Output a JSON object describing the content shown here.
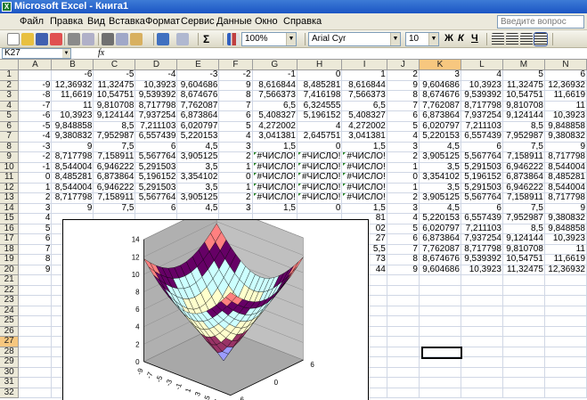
{
  "window": {
    "title": "Microsoft Excel - Книга1"
  },
  "menu": {
    "items": [
      "Файл",
      "Правка",
      "Вид",
      "Вставка",
      "Формат",
      "Сервис",
      "Данные",
      "Окно",
      "Справка"
    ],
    "help_placeholder": "Введите вопрос"
  },
  "toolbar": {
    "zoom": "100%",
    "font_name": "Arial Cyr",
    "font_size": "10",
    "bold": "Ж",
    "italic": "К",
    "underline": "Ч",
    "icons": [
      "new-icon",
      "open-icon",
      "save-icon",
      "permission-icon",
      "print-icon",
      "print-preview-icon",
      "cut-icon",
      "copy-icon",
      "paste-icon",
      "undo-icon",
      "redo-icon",
      "autosum-icon",
      "chart-wizard-icon",
      "align-left-icon",
      "align-center-icon",
      "align-right-icon",
      "merge-icon"
    ]
  },
  "formula_bar": {
    "name_box": "K27",
    "fx": "fx"
  },
  "sheet": {
    "columns": [
      "A",
      "B",
      "C",
      "D",
      "E",
      "F",
      "G",
      "H",
      "I",
      "J",
      "K",
      "L",
      "M",
      "N"
    ],
    "selected_column": "K",
    "selected_row": "27",
    "rows": [
      {
        "n": "1",
        "c": [
          "",
          "-6",
          "-5",
          "-4",
          "-3",
          "-2",
          "-1",
          "0",
          "1",
          "2",
          "3",
          "4",
          "5",
          "6"
        ]
      },
      {
        "n": "2",
        "c": [
          "-9",
          "12,36932",
          "11,32475",
          "10,3923",
          "9,604686",
          "9",
          "8,616844",
          "8,485281",
          "8,616844",
          "9",
          "9,604686",
          "10,3923",
          "11,32475",
          "12,36932"
        ]
      },
      {
        "n": "3",
        "c": [
          "-8",
          "11,6619",
          "10,54751",
          "9,539392",
          "8,674676",
          "8",
          "7,566373",
          "7,416198",
          "7,566373",
          "8",
          "8,674676",
          "9,539392",
          "10,54751",
          "11,6619"
        ]
      },
      {
        "n": "4",
        "c": [
          "-7",
          "11",
          "9,810708",
          "8,717798",
          "7,762087",
          "7",
          "6,5",
          "6,324555",
          "6,5",
          "7",
          "7,762087",
          "8,717798",
          "9,810708",
          "11"
        ]
      },
      {
        "n": "5",
        "c": [
          "-6",
          "10,3923",
          "9,124144",
          "7,937254",
          "6,873864",
          "6",
          "5,408327",
          "5,196152",
          "5,408327",
          "6",
          "6,873864",
          "7,937254",
          "9,124144",
          "10,3923"
        ]
      },
      {
        "n": "6",
        "c": [
          "-5",
          "9,848858",
          "8,5",
          "7,211103",
          "6,020797",
          "5",
          "4,272002",
          "4",
          "4,272002",
          "5",
          "6,020797",
          "7,211103",
          "8,5",
          "9,848858"
        ]
      },
      {
        "n": "7",
        "c": [
          "-4",
          "9,380832",
          "7,952987",
          "6,557439",
          "5,220153",
          "4",
          "3,041381",
          "2,645751",
          "3,041381",
          "4",
          "5,220153",
          "6,557439",
          "7,952987",
          "9,380832"
        ]
      },
      {
        "n": "8",
        "c": [
          "-3",
          "9",
          "7,5",
          "6",
          "4,5",
          "3",
          "1,5",
          "0",
          "1,5",
          "3",
          "4,5",
          "6",
          "7,5",
          "9"
        ]
      },
      {
        "n": "9",
        "c": [
          "-2",
          "8,717798",
          "7,158911",
          "5,567764",
          "3,905125",
          "2",
          "#ЧИСЛО!",
          "#ЧИСЛО!",
          "#ЧИСЛО!",
          "2",
          "3,905125",
          "5,567764",
          "7,158911",
          "8,717798"
        ]
      },
      {
        "n": "10",
        "c": [
          "-1",
          "8,544004",
          "6,946222",
          "5,291503",
          "3,5",
          "1",
          "#ЧИСЛО!",
          "#ЧИСЛО!",
          "#ЧИСЛО!",
          "1",
          "3,5",
          "5,291503",
          "6,946222",
          "8,544004"
        ]
      },
      {
        "n": "11",
        "c": [
          "0",
          "8,485281",
          "6,873864",
          "5,196152",
          "3,354102",
          "0",
          "#ЧИСЛО!",
          "#ЧИСЛО!",
          "#ЧИСЛО!",
          "0",
          "3,354102",
          "5,196152",
          "6,873864",
          "8,485281"
        ]
      },
      {
        "n": "12",
        "c": [
          "1",
          "8,544004",
          "6,946222",
          "5,291503",
          "3,5",
          "1",
          "#ЧИСЛО!",
          "#ЧИСЛО!",
          "#ЧИСЛО!",
          "1",
          "3,5",
          "5,291503",
          "6,946222",
          "8,544004"
        ]
      },
      {
        "n": "13",
        "c": [
          "2",
          "8,717798",
          "7,158911",
          "5,567764",
          "3,905125",
          "2",
          "#ЧИСЛО!",
          "#ЧИСЛО!",
          "#ЧИСЛО!",
          "2",
          "3,905125",
          "5,567764",
          "7,158911",
          "8,717798"
        ]
      },
      {
        "n": "14",
        "c": [
          "3",
          "9",
          "7,5",
          "6",
          "4,5",
          "3",
          "1,5",
          "0",
          "1,5",
          "3",
          "4,5",
          "6",
          "7,5",
          "9"
        ]
      },
      {
        "n": "15",
        "c": [
          "4",
          "",
          "",
          "",
          "",
          "",
          "",
          "",
          "81",
          "4",
          "5,220153",
          "6,557439",
          "7,952987",
          "9,380832"
        ]
      },
      {
        "n": "16",
        "c": [
          "5",
          "",
          "",
          "",
          "",
          "",
          "",
          "",
          "02",
          "5",
          "6,020797",
          "7,211103",
          "8,5",
          "9,848858"
        ]
      },
      {
        "n": "17",
        "c": [
          "6",
          "",
          "",
          "",
          "",
          "",
          "",
          "",
          "27",
          "6",
          "6,873864",
          "7,937254",
          "9,124144",
          "10,3923"
        ]
      },
      {
        "n": "18",
        "c": [
          "7",
          "",
          "",
          "",
          "",
          "",
          "",
          "",
          "5,5",
          "7",
          "7,762087",
          "8,717798",
          "9,810708",
          "11"
        ]
      },
      {
        "n": "19",
        "c": [
          "8",
          "",
          "",
          "",
          "",
          "",
          "",
          "",
          "73",
          "8",
          "8,674676",
          "9,539392",
          "10,54751",
          "11,6619"
        ]
      },
      {
        "n": "20",
        "c": [
          "9",
          "",
          "",
          "",
          "",
          "",
          "",
          "",
          "44",
          "9",
          "9,604686",
          "10,3923",
          "11,32475",
          "12,36932"
        ]
      },
      {
        "n": "21",
        "c": [
          "",
          "",
          "",
          "",
          "",
          "",
          "",
          "",
          "",
          "",
          "",
          "",
          "",
          ""
        ]
      },
      {
        "n": "22",
        "c": [
          "",
          "",
          "",
          "",
          "",
          "",
          "",
          "",
          "",
          "",
          "",
          "",
          "",
          ""
        ]
      },
      {
        "n": "23",
        "c": [
          "",
          "",
          "",
          "",
          "",
          "",
          "",
          "",
          "",
          "",
          "",
          "",
          "",
          ""
        ]
      },
      {
        "n": "24",
        "c": [
          "",
          "",
          "",
          "",
          "",
          "",
          "",
          "",
          "",
          "",
          "",
          "",
          "",
          ""
        ]
      },
      {
        "n": "25",
        "c": [
          "",
          "",
          "",
          "",
          "",
          "",
          "",
          "",
          "",
          "",
          "",
          "",
          "",
          ""
        ]
      },
      {
        "n": "26",
        "c": [
          "",
          "",
          "",
          "",
          "",
          "",
          "",
          "",
          "",
          "",
          "",
          "",
          "",
          ""
        ]
      },
      {
        "n": "27",
        "c": [
          "",
          "",
          "",
          "",
          "",
          "",
          "",
          "",
          "",
          "",
          "",
          "",
          "",
          ""
        ]
      },
      {
        "n": "28",
        "c": [
          "",
          "",
          "",
          "",
          "",
          "",
          "",
          "",
          "",
          "",
          "",
          "",
          "",
          ""
        ]
      },
      {
        "n": "29",
        "c": [
          "",
          "",
          "",
          "",
          "",
          "",
          "",
          "",
          "",
          "",
          "",
          "",
          "",
          ""
        ]
      },
      {
        "n": "30",
        "c": [
          "",
          "",
          "",
          "",
          "",
          "",
          "",
          "",
          "",
          "",
          "",
          "",
          "",
          ""
        ]
      },
      {
        "n": "31",
        "c": [
          "",
          "",
          "",
          "",
          "",
          "",
          "",
          "",
          "",
          "",
          "",
          "",
          "",
          ""
        ]
      },
      {
        "n": "32",
        "c": [
          "",
          "",
          "",
          "",
          "",
          "",
          "",
          "",
          "",
          "",
          "",
          "",
          "",
          ""
        ]
      }
    ]
  },
  "chart_data": {
    "type": "surface",
    "title": "",
    "z_ticks": [
      "0",
      "2",
      "4",
      "6",
      "8",
      "10",
      "12",
      "14"
    ],
    "x_ticks": [
      "-9",
      "-8",
      "-7",
      "-6",
      "-5",
      "-4",
      "-3",
      "-2",
      "-1",
      "0",
      "1",
      "2",
      "3",
      "4",
      "5",
      "6",
      "7",
      "8",
      "9"
    ],
    "y_ticks": [
      "6",
      "0",
      "-6"
    ],
    "band_colors": [
      "#9c9cff",
      "#993366",
      "#ffffcc",
      "#ccffff",
      "#660066",
      "#ff8080"
    ],
    "grid": true,
    "legend": "none"
  }
}
